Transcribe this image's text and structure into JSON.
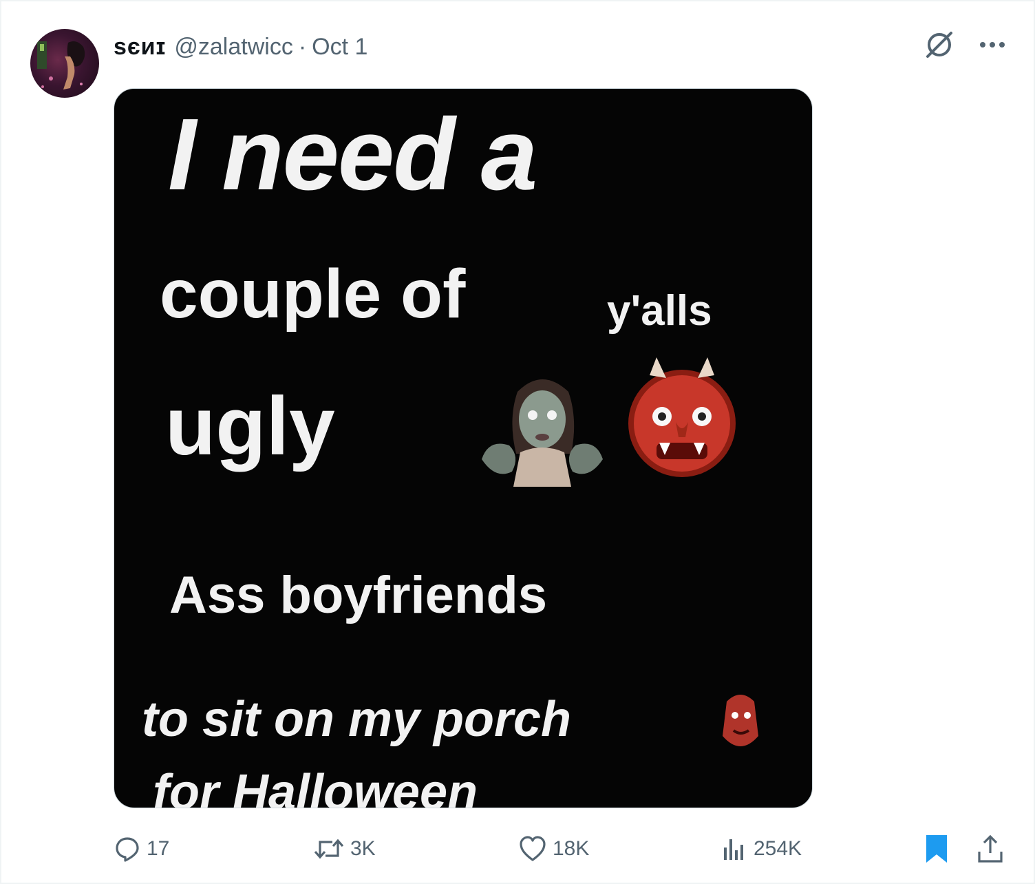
{
  "tweet": {
    "display_name": "ѕєиɪ",
    "handle": "@zalatwicc",
    "separator": "·",
    "date": "Oct 1"
  },
  "media": {
    "line1": "I need a",
    "line2": "couple of",
    "line2b": "y'alls",
    "line3": "ugly",
    "line4": "Ass boyfriends",
    "line5": "to sit on my porch",
    "line6": "for Halloween",
    "emoji_names": [
      "zombie-woman",
      "ogre",
      "goblin"
    ]
  },
  "actions": {
    "replies": "17",
    "reposts": "3K",
    "likes": "18K",
    "views": "254K"
  },
  "colors": {
    "text_secondary": "#536471",
    "bookmark_active": "#1d9bf0",
    "media_bg": "#050505"
  },
  "icons": [
    "grok-icon",
    "more-icon",
    "reply-icon",
    "repost-icon",
    "like-icon",
    "views-icon",
    "bookmark-icon",
    "share-icon"
  ]
}
